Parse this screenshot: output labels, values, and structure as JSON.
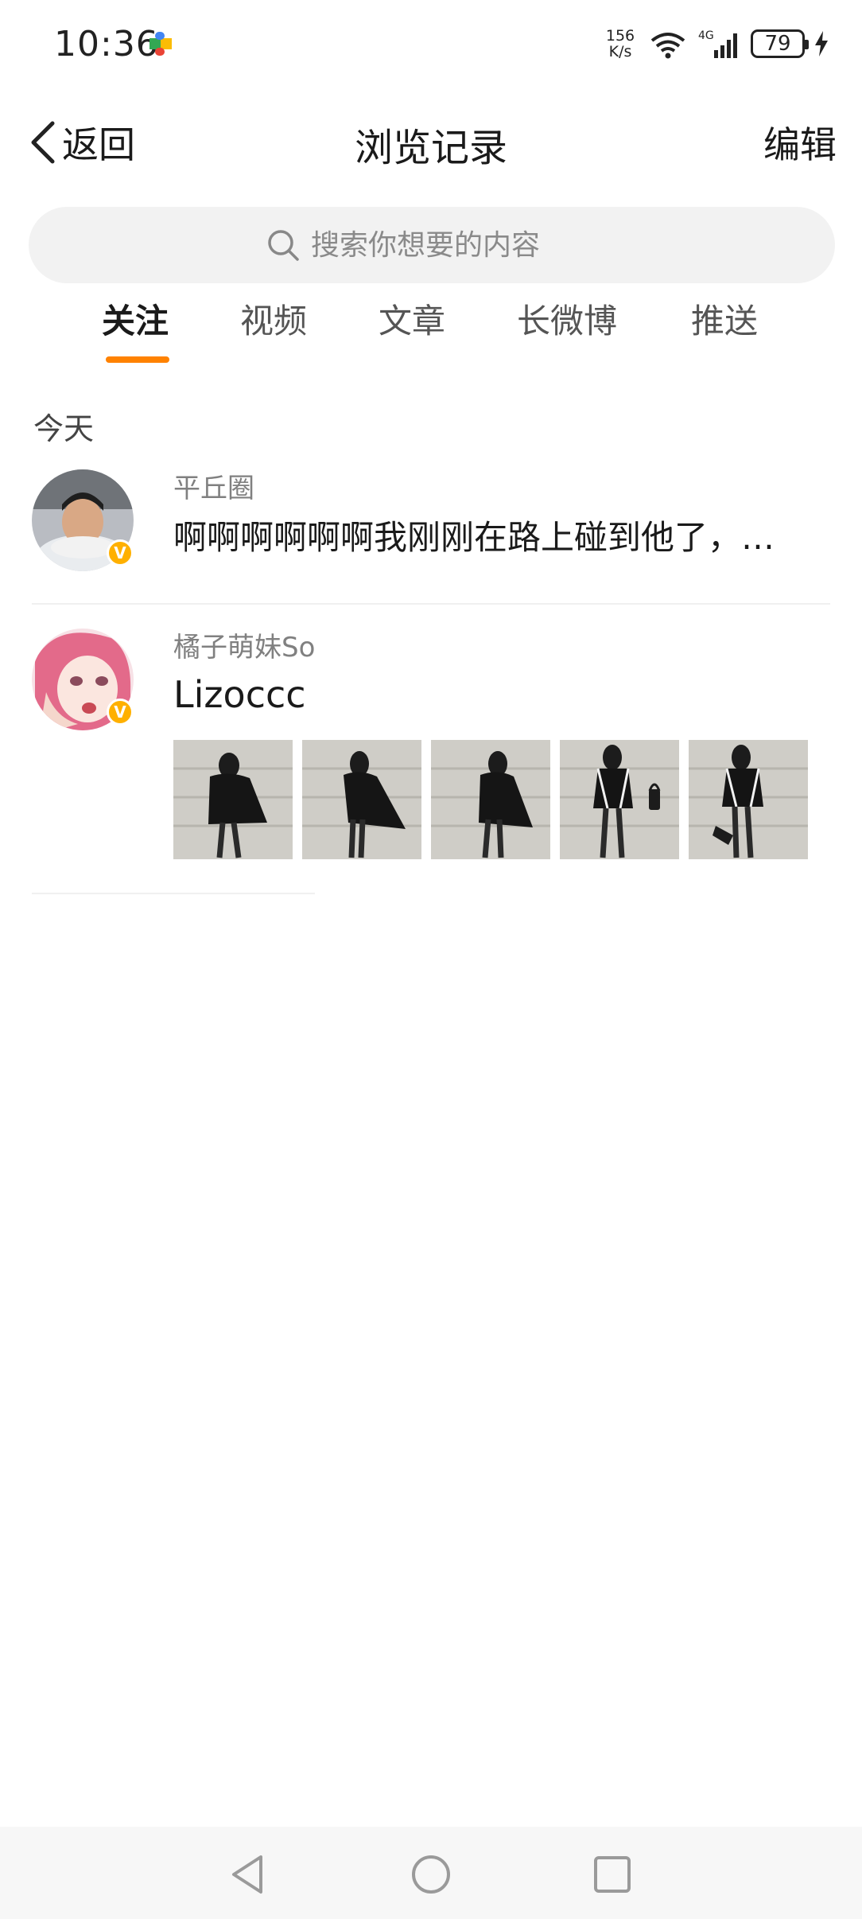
{
  "status_bar": {
    "time": "10:36",
    "net_speed_value": "156",
    "net_speed_unit": "K/s",
    "signal_label": "4G",
    "battery": "79",
    "app_icon": "puzzle-icon"
  },
  "header": {
    "back_label": "返回",
    "title": "浏览记录",
    "edit_label": "编辑"
  },
  "search": {
    "placeholder": "搜索你想要的内容"
  },
  "tabs": [
    {
      "label": "关注",
      "active": true
    },
    {
      "label": "视频",
      "active": false
    },
    {
      "label": "文章",
      "active": false
    },
    {
      "label": "长微博",
      "active": false
    },
    {
      "label": "推送",
      "active": false
    }
  ],
  "section": {
    "label": "今天"
  },
  "items": [
    {
      "author": "平丘圈",
      "text": "啊啊啊啊啊啊我刚刚在路上碰到他了，…",
      "verified": true,
      "images": 0
    },
    {
      "author": "橘子萌妹So",
      "text": "Lizoccc",
      "verified": true,
      "images": 5
    }
  ],
  "colors": {
    "accent": "#ff8200",
    "badge": "#ffb000"
  },
  "nav": {
    "back": "triangle-back-icon",
    "home": "circle-home-icon",
    "recent": "square-recent-icon"
  }
}
